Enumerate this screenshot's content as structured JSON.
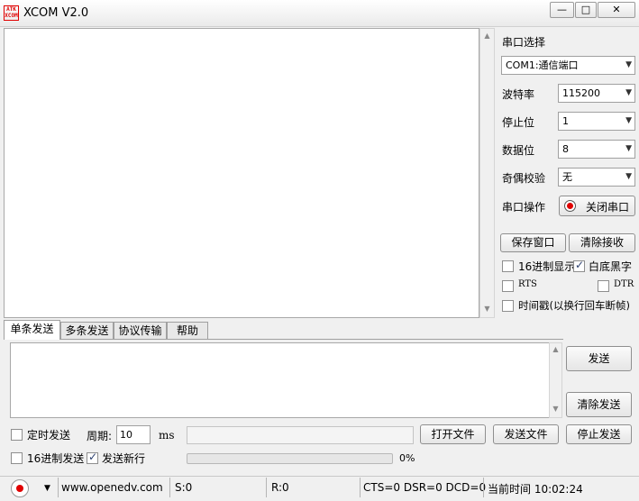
{
  "window": {
    "logo_text": "ATK XCOM",
    "title": "XCOM V2.0",
    "minimize_glyph": "—",
    "maximize_glyph": "□",
    "close_glyph": "✕"
  },
  "serial": {
    "port_label": "串口选择",
    "port_value": "COM1:通信端口",
    "baud_label": "波特率",
    "baud_value": "115200",
    "stop_label": "停止位",
    "stop_value": "1",
    "data_label": "数据位",
    "data_value": "8",
    "parity_label": "奇偶校验",
    "parity_value": "无",
    "op_label": "串口操作",
    "op_button": "关闭串口",
    "save_window": "保存窗口",
    "clear_recv": "清除接收",
    "hex_display": "16进制显示",
    "white_black": "白底黑字",
    "rts": "RTS",
    "dtr": "DTR",
    "timestamp": "时间戳(以换行回车断帧)"
  },
  "checks": {
    "hex_display": false,
    "white_black": true,
    "rts": false,
    "dtr": false,
    "timestamp": false,
    "timed_send": false,
    "hex_send": false,
    "send_newline": true
  },
  "tabs": [
    "单条发送",
    "多条发送",
    "协议传输",
    "帮助"
  ],
  "send": {
    "send_button": "发送",
    "clear_send": "清除发送",
    "timed_send": "定时发送",
    "period_label": "周期:",
    "period_value": "10",
    "period_unit": "ms",
    "open_file": "打开文件",
    "send_file": "发送文件",
    "stop_send": "停止发送",
    "hex_send": "16进制发送",
    "send_newline": "发送新行",
    "progress": "0%",
    "progress_value": 0
  },
  "status": {
    "website": "www.openedv.com",
    "sent": "S:0",
    "received": "R:0",
    "lines": "CTS=0 DSR=0 DCD=0",
    "time": "当前时间 10:02:24"
  },
  "colors": {
    "record_button": "#e00000",
    "accent": "#2a3e6e"
  }
}
